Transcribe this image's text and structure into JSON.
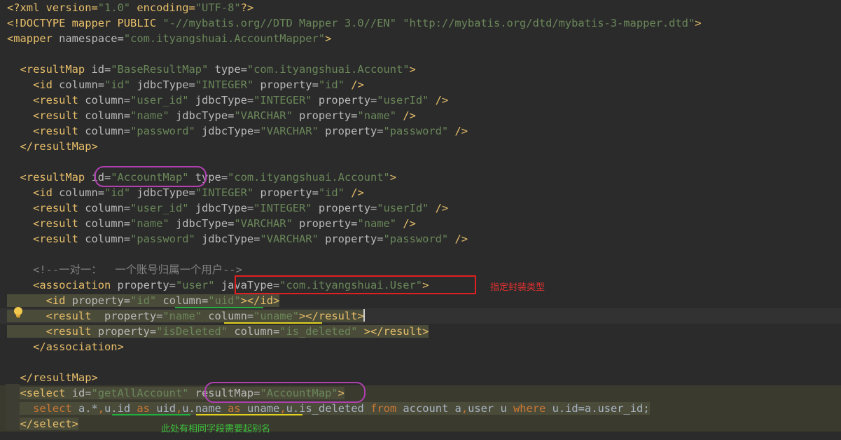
{
  "editor": {
    "lines": [
      {
        "id": "l1",
        "spans": [
          [
            "pi",
            "<?xml version="
          ],
          [
            "val",
            "\"1.0\""
          ],
          [
            "pi",
            " encoding="
          ],
          [
            "val",
            "\"UTF-8\""
          ],
          [
            "pi",
            "?>"
          ]
        ]
      },
      {
        "id": "l2",
        "spans": [
          [
            "doctype",
            "<!DOCTYPE mapper PUBLIC "
          ],
          [
            "val",
            "\"-//mybatis.org//DTD Mapper 3.0//EN\""
          ],
          [
            "doctype",
            " "
          ],
          [
            "val",
            "\"http://mybatis.org/dtd/mybatis-3-mapper.dtd\""
          ],
          [
            "doctype",
            ">"
          ]
        ]
      },
      {
        "id": "l3",
        "spans": [
          [
            "tag",
            "<mapper "
          ],
          [
            "attr",
            "namespace="
          ],
          [
            "val",
            "\"com.ityangshuai.AccountMapper\""
          ],
          [
            "tag",
            ">"
          ]
        ]
      },
      {
        "id": "l4",
        "spans": []
      },
      {
        "id": "l5",
        "spans": [
          [
            "tag",
            "  <resultMap "
          ],
          [
            "attr",
            "id="
          ],
          [
            "val",
            "\"BaseResultMap\""
          ],
          [
            "attr",
            " type="
          ],
          [
            "val",
            "\"com.ityangshuai.Account\""
          ],
          [
            "tag",
            ">"
          ]
        ]
      },
      {
        "id": "l6",
        "spans": [
          [
            "tag",
            "    <id "
          ],
          [
            "attr",
            "column="
          ],
          [
            "val",
            "\"id\""
          ],
          [
            "attr",
            " jdbcType="
          ],
          [
            "val",
            "\"INTEGER\""
          ],
          [
            "attr",
            " property="
          ],
          [
            "val",
            "\"id\""
          ],
          [
            "tag",
            " />"
          ]
        ]
      },
      {
        "id": "l7",
        "spans": [
          [
            "tag",
            "    <result "
          ],
          [
            "attr",
            "column="
          ],
          [
            "val",
            "\"user_id\""
          ],
          [
            "attr",
            " jdbcType="
          ],
          [
            "val",
            "\"INTEGER\""
          ],
          [
            "attr",
            " property="
          ],
          [
            "val",
            "\"userId\""
          ],
          [
            "tag",
            " />"
          ]
        ]
      },
      {
        "id": "l8",
        "spans": [
          [
            "tag",
            "    <result "
          ],
          [
            "attr",
            "column="
          ],
          [
            "val",
            "\"name\""
          ],
          [
            "attr",
            " jdbcType="
          ],
          [
            "val",
            "\"VARCHAR\""
          ],
          [
            "attr",
            " property="
          ],
          [
            "val",
            "\"name\""
          ],
          [
            "tag",
            " />"
          ]
        ]
      },
      {
        "id": "l9",
        "spans": [
          [
            "tag",
            "    <result "
          ],
          [
            "attr",
            "column="
          ],
          [
            "val",
            "\"password\""
          ],
          [
            "attr",
            " jdbcType="
          ],
          [
            "val",
            "\"VARCHAR\""
          ],
          [
            "attr",
            " property="
          ],
          [
            "val",
            "\"password\""
          ],
          [
            "tag",
            " />"
          ]
        ]
      },
      {
        "id": "l10",
        "spans": [
          [
            "tag",
            "  </resultMap>"
          ]
        ]
      },
      {
        "id": "l11",
        "spans": []
      },
      {
        "id": "l12",
        "spans": [
          [
            "tag",
            "  <resultMap "
          ],
          [
            "attr",
            "id="
          ],
          [
            "val",
            "\"AccountMap\""
          ],
          [
            "attr",
            " type="
          ],
          [
            "val",
            "\"com.ityangshuai.Account\""
          ],
          [
            "tag",
            ">"
          ]
        ]
      },
      {
        "id": "l13",
        "spans": [
          [
            "tag",
            "    <id "
          ],
          [
            "attr",
            "column="
          ],
          [
            "val",
            "\"id\""
          ],
          [
            "attr",
            " jdbcType="
          ],
          [
            "val",
            "\"INTEGER\""
          ],
          [
            "attr",
            " property="
          ],
          [
            "val",
            "\"id\""
          ],
          [
            "tag",
            " />"
          ]
        ]
      },
      {
        "id": "l14",
        "spans": [
          [
            "tag",
            "    <result "
          ],
          [
            "attr",
            "column="
          ],
          [
            "val",
            "\"user_id\""
          ],
          [
            "attr",
            " jdbcType="
          ],
          [
            "val",
            "\"INTEGER\""
          ],
          [
            "attr",
            " property="
          ],
          [
            "val",
            "\"userId\""
          ],
          [
            "tag",
            " />"
          ]
        ]
      },
      {
        "id": "l15",
        "spans": [
          [
            "tag",
            "    <result "
          ],
          [
            "attr",
            "column="
          ],
          [
            "val",
            "\"name\""
          ],
          [
            "attr",
            " jdbcType="
          ],
          [
            "val",
            "\"VARCHAR\""
          ],
          [
            "attr",
            " property="
          ],
          [
            "val",
            "\"name\""
          ],
          [
            "tag",
            " />"
          ]
        ]
      },
      {
        "id": "l16",
        "spans": [
          [
            "tag",
            "    <result "
          ],
          [
            "attr",
            "column="
          ],
          [
            "val",
            "\"password\""
          ],
          [
            "attr",
            " jdbcType="
          ],
          [
            "val",
            "\"VARCHAR\""
          ],
          [
            "attr",
            " property="
          ],
          [
            "val",
            "\"password\""
          ],
          [
            "tag",
            " />"
          ]
        ]
      },
      {
        "id": "l17",
        "spans": []
      },
      {
        "id": "l18",
        "spans": [
          [
            "comment",
            "    <!--一对一：  一个账号归属一个用户-->"
          ]
        ]
      },
      {
        "id": "l19",
        "spans": [
          [
            "tag",
            "    <association "
          ],
          [
            "attr",
            "property="
          ],
          [
            "val",
            "\"user\""
          ],
          [
            "attr",
            " javaType="
          ],
          [
            "val",
            "\"com.ityangshuai.User\""
          ],
          [
            "tag",
            ">"
          ]
        ]
      },
      {
        "id": "l20",
        "spans": [
          [
            "tag",
            "      <id "
          ],
          [
            "attr",
            "property="
          ],
          [
            "val",
            "\"id\""
          ],
          [
            "attr",
            " column="
          ],
          [
            "val",
            "\"uid\""
          ],
          [
            "tag",
            "></id>"
          ]
        ]
      },
      {
        "id": "l21",
        "spans": [
          [
            "tag",
            "      <result  "
          ],
          [
            "attr",
            "property="
          ],
          [
            "val",
            "\"name\""
          ],
          [
            "attr",
            " column="
          ],
          [
            "val",
            "\"uname\""
          ],
          [
            "tag",
            "></result>"
          ]
        ]
      },
      {
        "id": "l22",
        "spans": [
          [
            "tag",
            "      <result "
          ],
          [
            "attr",
            "property="
          ],
          [
            "val",
            "\"isDeleted\""
          ],
          [
            "attr",
            " column="
          ],
          [
            "val",
            "\"is_deleted\""
          ],
          [
            "tag",
            " ></result>"
          ]
        ]
      },
      {
        "id": "l23",
        "spans": [
          [
            "tag",
            "    </association>"
          ]
        ]
      },
      {
        "id": "l24",
        "spans": []
      },
      {
        "id": "l25",
        "spans": [
          [
            "tag",
            "  </resultMap>"
          ]
        ]
      },
      {
        "id": "l26",
        "spans": [
          [
            "tag",
            "  <select "
          ],
          [
            "attr",
            "id="
          ],
          [
            "val",
            "\"getAllAccount\""
          ],
          [
            "attr",
            " resultMap="
          ],
          [
            "val",
            "\"AccountMap\""
          ],
          [
            "tag",
            ">"
          ]
        ]
      },
      {
        "id": "l27",
        "spans": [
          [
            "sqlkw",
            "    select "
          ],
          [
            "sql",
            "a.*"
          ],
          [
            "sqlkw",
            ","
          ],
          [
            "sql",
            "u.id "
          ],
          [
            "sqlkw",
            "as "
          ],
          [
            "sql",
            "uid"
          ],
          [
            "sqlkw",
            ","
          ],
          [
            "sql",
            "u.name "
          ],
          [
            "sqlkw",
            "as "
          ],
          [
            "sql",
            "uname"
          ],
          [
            "sqlkw",
            ","
          ],
          [
            "sql",
            "u.is_deleted "
          ],
          [
            "sqlkw",
            "from "
          ],
          [
            "sql",
            "account a"
          ],
          [
            "sqlkw",
            ","
          ],
          [
            "sql",
            "user "
          ],
          [
            "sql",
            "u "
          ],
          [
            "sqlkw",
            "where "
          ],
          [
            "sql",
            "u.id=a.user_id;"
          ]
        ]
      },
      {
        "id": "l28",
        "spans": [
          [
            "tag",
            "  </select>"
          ]
        ]
      }
    ]
  },
  "annotations": {
    "java_type_note": "指定封装类型",
    "alias_note": "此处有相同字段需要起别名"
  },
  "colors": {
    "background": "#2b2b2b",
    "tag": "#e8bf6a",
    "attribute": "#bababa",
    "value": "#6a8759",
    "comment": "#808080",
    "sql_keyword": "#cc7832",
    "red_box": "#e02020",
    "purple_circle": "#b040b0",
    "green_underline": "#20b040",
    "yellow_underline": "#e0d020",
    "red_note": "#e03030",
    "green_note": "#3cc03c"
  },
  "icons": {
    "intention_bulb": "lightbulb-icon"
  }
}
